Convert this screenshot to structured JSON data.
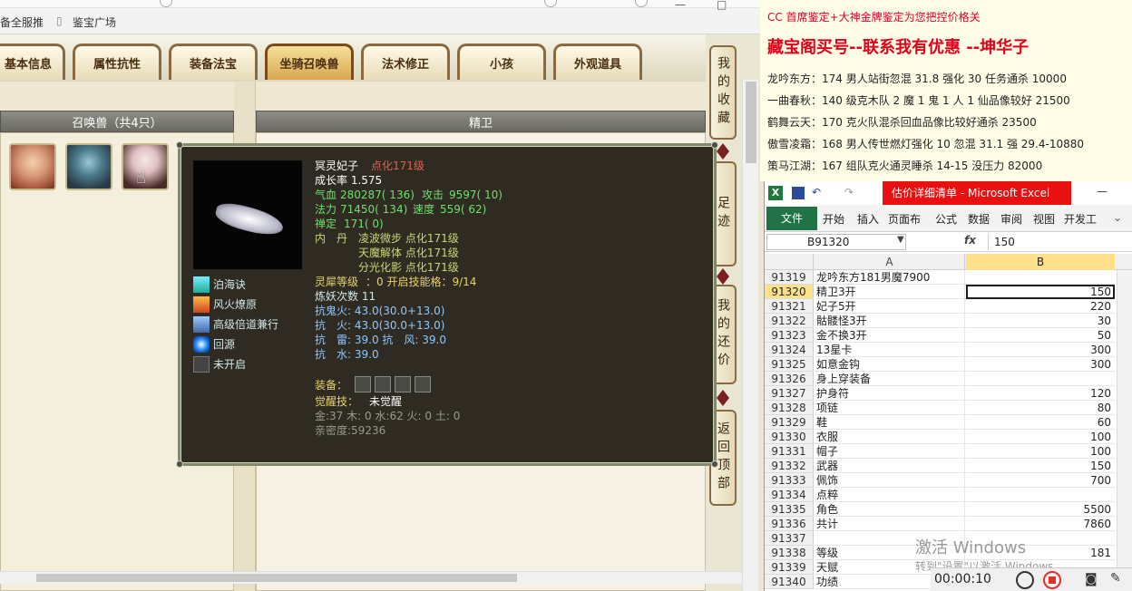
{
  "browser": {
    "bookmarks": [
      "备全服推",
      "鉴宝广场"
    ],
    "window_controls": [
      "—",
      "□"
    ]
  },
  "game": {
    "tabs": [
      "基本信息",
      "属性抗性",
      "装备法宝",
      "坐骑召唤兽",
      "法术修正",
      "小孩",
      "外观道具"
    ],
    "active_tab": "坐骑召唤兽",
    "summon_panel_title": "召唤兽（共4只）",
    "detail_panel_title": "精卫",
    "side_tabs": [
      {
        "label": "我的收藏"
      },
      {
        "label": "足迹"
      },
      {
        "label": "我的还价"
      },
      {
        "label": "返回顶部"
      }
    ]
  },
  "tooltip": {
    "name": "冥灵妃子",
    "name_tag": "点化171级",
    "growth": "成长率 1.575",
    "hp_label": "气血",
    "hp": "280287( 136)",
    "atk_label": "攻击",
    "atk": "9597( 10)",
    "mp_label": "法力",
    "mp": "71450( 134)",
    "spd_label": "速度",
    "spd": "559( 62)",
    "def_label": "禅定",
    "def": "171( 0)",
    "dan_label": "内　丹",
    "dan": [
      "凌波微步 点化171级",
      "天魔解体 点化171级",
      "分光化影 点化171级"
    ],
    "lingxi_label": "灵犀等级",
    "lingxi": "：0 开启技能格：9/14",
    "refine": "炼妖次数 11",
    "resist": [
      "抗鬼火: 43.0(30.0+13.0)",
      "抗　火: 43.0(30.0+13.0)",
      "抗　雷: 39.0 抗　风: 39.0",
      "抗　水: 39.0"
    ],
    "equip_label": "装备：",
    "awaken_label": "觉醒技：",
    "awaken": "未觉醒",
    "elements": "金:37 木: 0 水:62 火: 0 土: 0",
    "intimacy": "亲密度:59236",
    "skills": [
      "泊海诀",
      "风火燎原",
      "高级倍道兼行",
      "回源",
      "未开启"
    ]
  },
  "notes": {
    "line1": "CC 首席鉴定+大神金牌鉴定为您把控价格关",
    "line2": "藏宝阁买号--联系我有优惠 --坤华子",
    "items": [
      "龙吟东方：174 男人站街忽混 31.8 强化 30 任务通杀 10000",
      "一曲春秋：140 级克木队 2 魔 1 鬼 1 人 1 仙品像较好 21500",
      "鹤舞云天：170 克火队混杀回血品像比较好通杀 23500",
      "傲雪凌霜：168 男人传世燃灯强化 10 忽混 31.1 强 29.4-10880",
      "策马江湖：167 组队克火通灵睡杀 14-15 没压力 82000"
    ]
  },
  "excel": {
    "title": "估价详细清单 - Microsoft Excel",
    "ribbon": [
      "文件",
      "开始",
      "插入",
      "页面布",
      "公式",
      "数据",
      "审阅",
      "视图",
      "开发工"
    ],
    "name_box": "B91320",
    "fx": "fx",
    "formula": "150",
    "col_a": "A",
    "col_b": "B",
    "rows": [
      {
        "n": "91319",
        "a": "龙吟东方181男魔7900",
        "b": ""
      },
      {
        "n": "91320",
        "a": "精卫3开",
        "b": "150"
      },
      {
        "n": "91321",
        "a": "妃子5开",
        "b": "220"
      },
      {
        "n": "91322",
        "a": "骷髅怪3开",
        "b": "30"
      },
      {
        "n": "91323",
        "a": "金不换3开",
        "b": "50"
      },
      {
        "n": "91324",
        "a": "13星卡",
        "b": "300"
      },
      {
        "n": "91325",
        "a": "如意金钩",
        "b": "300"
      },
      {
        "n": "91326",
        "a": "身上穿装备",
        "b": ""
      },
      {
        "n": "91327",
        "a": "护身符",
        "b": "120"
      },
      {
        "n": "91328",
        "a": "项链",
        "b": "80"
      },
      {
        "n": "91329",
        "a": "鞋",
        "b": "60"
      },
      {
        "n": "91330",
        "a": "衣服",
        "b": "100"
      },
      {
        "n": "91331",
        "a": "帽子",
        "b": "100"
      },
      {
        "n": "91332",
        "a": "武器",
        "b": "150"
      },
      {
        "n": "91333",
        "a": "佩饰",
        "b": "700"
      },
      {
        "n": "91334",
        "a": "点粹",
        "b": ""
      },
      {
        "n": "91335",
        "a": "角色",
        "b": "5500"
      },
      {
        "n": "91336",
        "a": "共计",
        "b": "7860"
      },
      {
        "n": "91337",
        "a": "",
        "b": ""
      },
      {
        "n": "91338",
        "a": "等级",
        "b": "181"
      },
      {
        "n": "91339",
        "a": "天赋",
        "b": ""
      },
      {
        "n": "91340",
        "a": "功绩",
        "b": ""
      }
    ],
    "watermark1": "激活 Windows",
    "watermark2": "转到\"设置\"以激活 Windows。"
  },
  "recorder": {
    "time": "00:00:10"
  }
}
